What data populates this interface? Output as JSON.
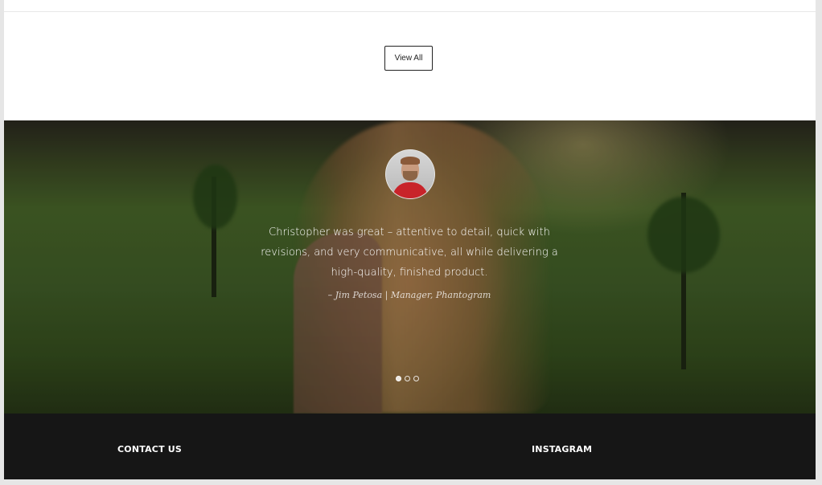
{
  "section": {
    "view_all_label": "View All"
  },
  "testimonial": {
    "quote": "Christopher was great – attentive to detail, quick with revisions, and very communicative, all while delivering a high-quality, finished product.",
    "citation": "– Jim Petosa | Manager, Phantogram",
    "slides_total": 3,
    "active_slide": 1
  },
  "footer": {
    "contact_heading": "CONTACT US",
    "instagram_heading": "INSTAGRAM"
  }
}
